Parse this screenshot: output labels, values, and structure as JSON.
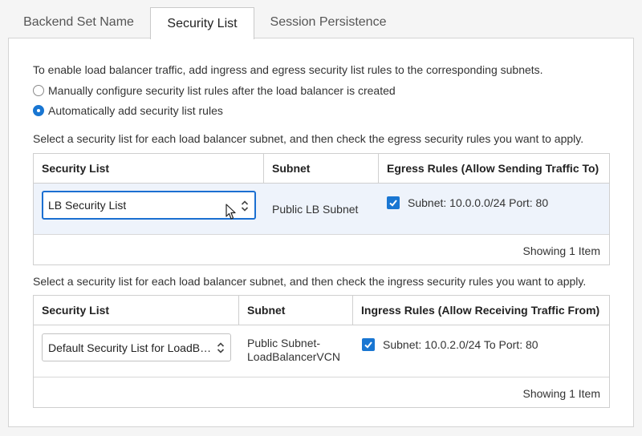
{
  "tabs": [
    {
      "label": "Backend Set Name"
    },
    {
      "label": "Security List",
      "active": true
    },
    {
      "label": "Session Persistence"
    }
  ],
  "panel": {
    "intro": "To enable load balancer traffic, add ingress and egress security list rules to the corresponding subnets.",
    "radio_manual": "Manually configure security list rules after the load balancer is created",
    "radio_auto": "Automatically add security list rules",
    "selected_option": "auto",
    "egress_instruction": "Select a security list for each load balancer subnet, and then check the egress security rules you want to apply.",
    "ingress_instruction": "Select a security list for each load balancer subnet, and then check the ingress security rules you want to apply."
  },
  "egress_table": {
    "headers": [
      "Security List",
      "Subnet",
      "Egress Rules (Allow Sending Traffic To)"
    ],
    "row": {
      "security_list": "LB Security List",
      "subnet": "Public LB Subnet",
      "rule": "Subnet: 10.0.0.0/24 Port: 80",
      "checked": true
    },
    "footer": "Showing 1 Item"
  },
  "ingress_table": {
    "headers": [
      "Security List",
      "Subnet",
      "Ingress Rules (Allow Receiving Traffic From)"
    ],
    "row": {
      "security_list": "Default Security List for LoadBalancerVCN",
      "subnet_line1": "Public Subnet-",
      "subnet_line2": "LoadBalancerVCN",
      "rule": "Subnet: 10.0.2.0/24 To Port: 80",
      "checked": true
    },
    "footer": "Showing 1 Item"
  },
  "colors": {
    "accent": "#1976d2",
    "focus_border": "#1b6fd1",
    "row_highlight": "#eef3fb"
  },
  "icons": {
    "select_arrows": "chevron-up-down-icon",
    "checkbox": "check-icon",
    "cursor": "mouse-pointer-icon"
  }
}
